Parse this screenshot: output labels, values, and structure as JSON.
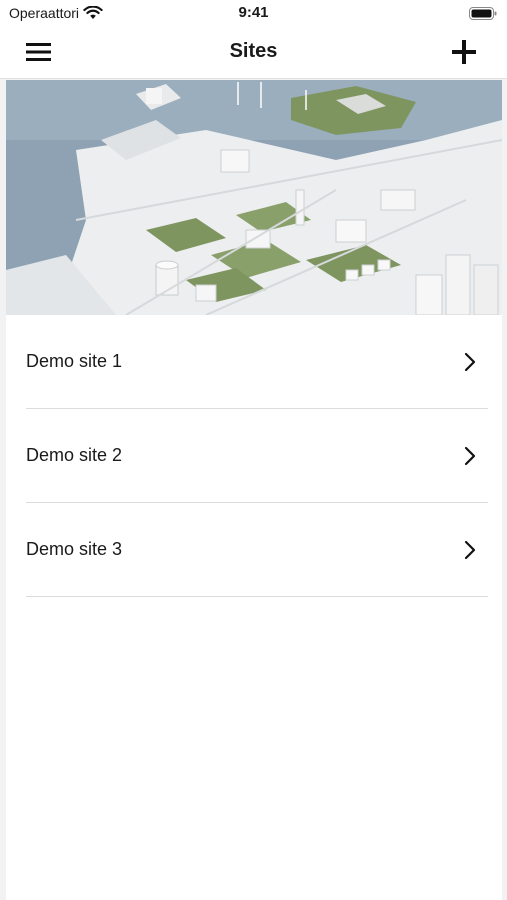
{
  "status_bar": {
    "carrier": "Operaattori",
    "time": "9:41",
    "icons": [
      "wifi-icon",
      "battery-icon"
    ]
  },
  "nav": {
    "title": "Sites",
    "left_icon": "hamburger-menu-icon",
    "right_icon": "plus-icon"
  },
  "hero_image": {
    "subject": "isometric city illustration"
  },
  "sites": [
    {
      "label": "Demo site 1"
    },
    {
      "label": "Demo site 2"
    },
    {
      "label": "Demo site 3"
    }
  ],
  "colors": {
    "water": "#8fa2b3",
    "land": "#eceeef",
    "greenery": "#7f9560",
    "divider": "#dcdcdc"
  }
}
